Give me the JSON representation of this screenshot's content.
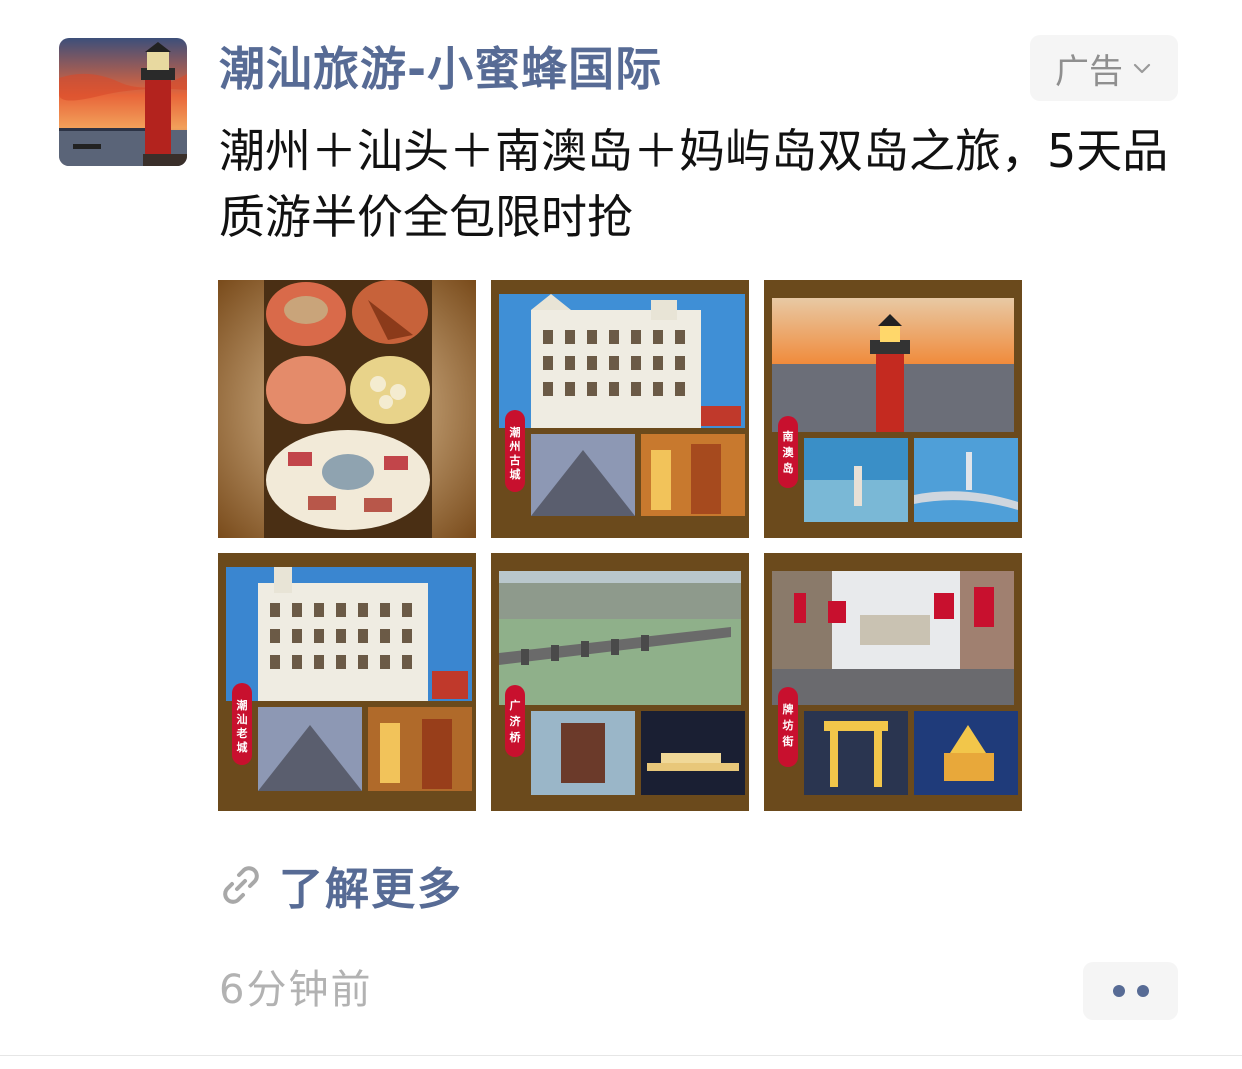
{
  "post": {
    "author": "潮汕旅游-小蜜蜂国际",
    "ad_label": "广告",
    "text": "潮州＋汕头＋南澳岛＋妈屿岛双岛之旅，5天品质游半价全包限时抢",
    "learn_more": "了解更多",
    "time": "6分钟前"
  },
  "images": [
    {
      "name": "food-collage",
      "label": ""
    },
    {
      "name": "chaozhou-ancient-city",
      "label": "潮州古城"
    },
    {
      "name": "nanao-island",
      "label": "南澳岛"
    },
    {
      "name": "chaoshan-old-town",
      "label": "潮汕老城"
    },
    {
      "name": "guangji-bridge",
      "label": "广济桥"
    },
    {
      "name": "paifang-street",
      "label": "牌坊街"
    }
  ],
  "icons": {
    "ad_dropdown": "chevron-down-icon",
    "learn_more": "link-icon",
    "more_options": "more-dots-icon"
  },
  "colors": {
    "link_blue": "#576b95",
    "time_gray": "#b2b2b2",
    "button_bg": "#f5f5f5",
    "frame_brown": "#6b4a1c",
    "label_red": "#c8102e"
  }
}
